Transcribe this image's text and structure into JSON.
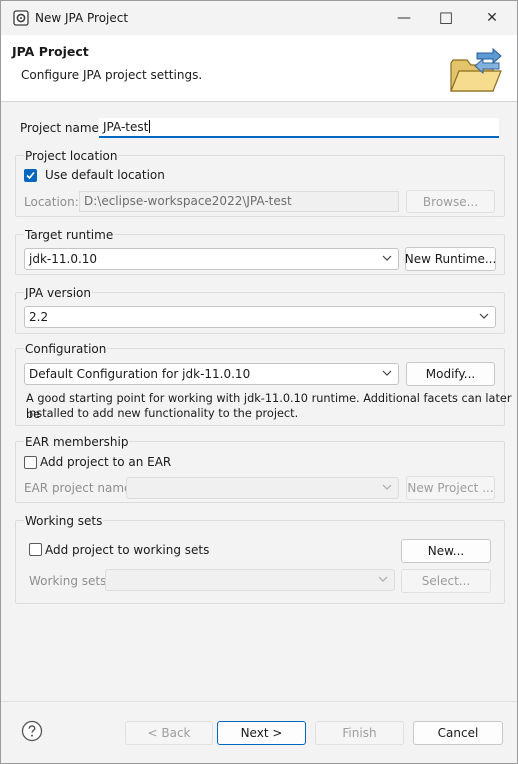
{
  "window": {
    "title": "New JPA Project",
    "minimize_glyph": "—",
    "maximize_glyph": "☐",
    "close_glyph": "✕"
  },
  "banner": {
    "title": "JPA Project",
    "subtitle": "Configure JPA project settings.",
    "icon": "folder-arrows-icon"
  },
  "project_name": {
    "label": "Project name:",
    "value": "JPA-test"
  },
  "project_location": {
    "group_label": "Project location",
    "use_default_label": "Use default location",
    "use_default_checked": true,
    "location_label": "Location:",
    "location_value": "D:\\eclipse-workspace2022\\JPA-test",
    "browse_label": "Browse..."
  },
  "target_runtime": {
    "group_label": "Target runtime",
    "selected": "jdk-11.0.10",
    "new_runtime_label": "New Runtime..."
  },
  "jpa_version": {
    "group_label": "JPA version",
    "selected": "2.2"
  },
  "configuration": {
    "group_label": "Configuration",
    "selected": "Default Configuration for jdk-11.0.10",
    "modify_label": "Modify...",
    "description_line1": "A good starting point for working with jdk-11.0.10 runtime. Additional facets can later be",
    "description_line2": "installed to add new functionality to the project."
  },
  "ear_membership": {
    "group_label": "EAR membership",
    "add_to_ear_label": "Add project to an EAR",
    "add_to_ear_checked": false,
    "ear_project_label": "EAR project name:",
    "ear_project_value": "",
    "new_project_label": "New Project ..."
  },
  "working_sets": {
    "group_label": "Working sets",
    "add_label": "Add project to working sets",
    "add_checked": false,
    "new_label": "New...",
    "sets_label": "Working sets:",
    "sets_value": "",
    "select_label": "Select..."
  },
  "footer": {
    "help_icon": "help-icon",
    "back_label": "< Back",
    "next_label": "Next >",
    "finish_label": "Finish",
    "cancel_label": "Cancel"
  },
  "colors": {
    "accent": "#0067c0",
    "banner_bg": "#ffffff",
    "dialog_bg": "#f3f3f3"
  }
}
